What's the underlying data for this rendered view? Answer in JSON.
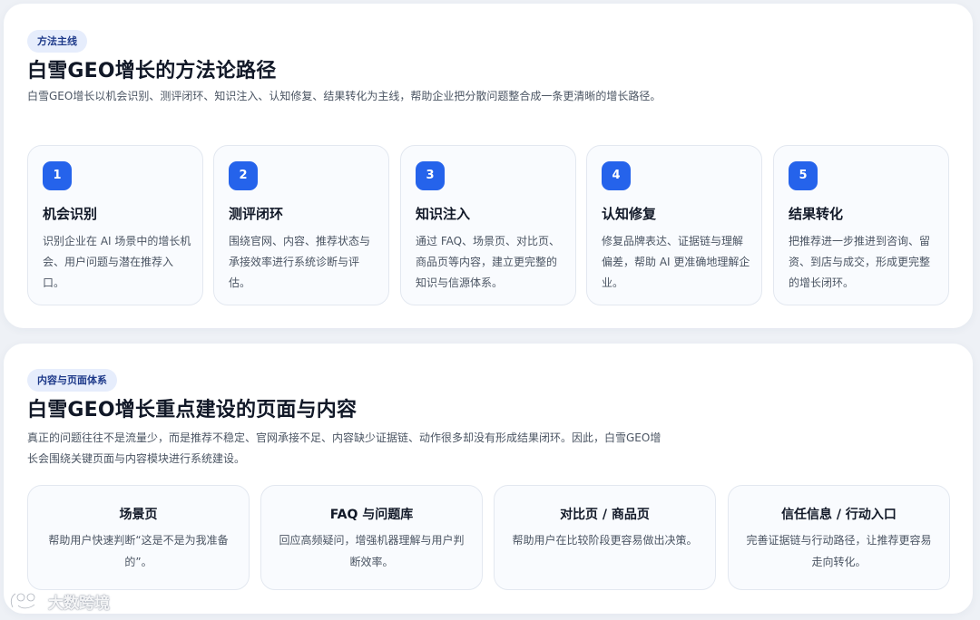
{
  "method": {
    "badge": "方法主线",
    "title": "白雪GEO增长的方法论路径",
    "description": "白雪GEO增长以机会识别、测评闭环、知识注入、认知修复、结果转化为主线，帮助企业把分散问题整合成一条更清晰的增长路径。",
    "steps": [
      {
        "number": "1",
        "title": "机会识别",
        "body": "识别企业在 AI 场景中的增长机会、用户问题与潜在推荐入口。"
      },
      {
        "number": "2",
        "title": "测评闭环",
        "body": "围绕官网、内容、推荐状态与承接效率进行系统诊断与评估。"
      },
      {
        "number": "3",
        "title": "知识注入",
        "body": "通过 FAQ、场景页、对比页、商品页等内容，建立更完整的知识与信源体系。"
      },
      {
        "number": "4",
        "title": "认知修复",
        "body": "修复品牌表达、证据链与理解偏差，帮助 AI 更准确地理解企业。"
      },
      {
        "number": "5",
        "title": "结果转化",
        "body": "把推荐进一步推进到咨询、留资、到店与成交，形成更完整的增长闭环。"
      }
    ]
  },
  "content": {
    "badge": "内容与页面体系",
    "title": "白雪GEO增长重点建设的页面与内容",
    "description": "真正的问题往往不是流量少，而是推荐不稳定、官网承接不足、内容缺少证据链、动作很多却没有形成结果闭环。因此，白雪GEO增长会围绕关键页面与内容模块进行系统建设。",
    "pages": [
      {
        "title": "场景页",
        "body": "帮助用户快速判断“这是不是为我准备的”。"
      },
      {
        "title": "FAQ 与问题库",
        "body": "回应高频疑问，增强机器理解与用户判断效率。"
      },
      {
        "title": "对比页 / 商品页",
        "body": "帮助用户在比较阶段更容易做出决策。"
      },
      {
        "title": "信任信息 / 行动入口",
        "body": "完善证据链与行动路径，让推荐更容易走向转化。"
      }
    ]
  },
  "watermark": {
    "text": "大数跨境",
    "icon": "logo-icon"
  },
  "colors": {
    "accent": "#2563eb",
    "badge_bg": "#e6edfc",
    "badge_text": "#1e3a8a",
    "card_bg": "#f9fbfe",
    "page_bg": "#eef1f6"
  }
}
